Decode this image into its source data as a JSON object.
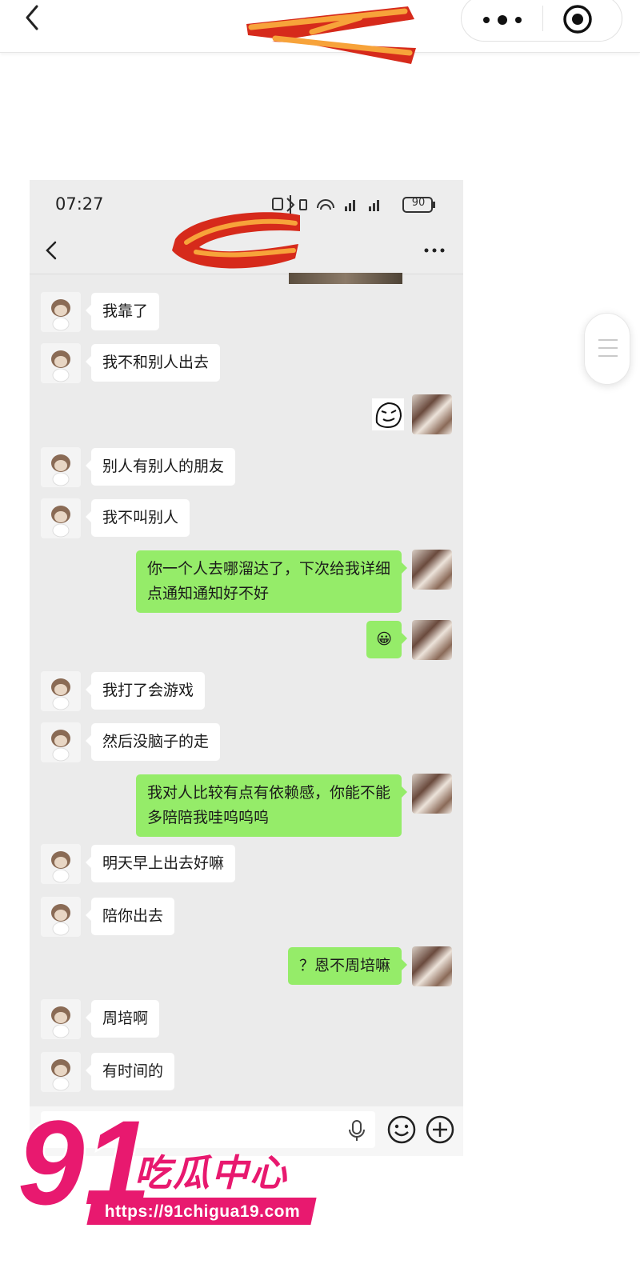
{
  "status_bar": {
    "time": "07:27",
    "battery": "90"
  },
  "messages": [
    {
      "side": "in",
      "type": "text",
      "lines": [
        "我靠了"
      ]
    },
    {
      "side": "in",
      "type": "text",
      "lines": [
        "我不和别人出去"
      ]
    },
    {
      "side": "out",
      "type": "sticker",
      "sticker": "meme-face-sticker"
    },
    {
      "side": "in",
      "type": "text",
      "lines": [
        "别人有别人的朋友"
      ]
    },
    {
      "side": "in",
      "type": "text",
      "lines": [
        "我不叫别人"
      ]
    },
    {
      "side": "out",
      "type": "text",
      "lines": [
        "你一个人去哪溜达了，下次给我详细",
        "点通知通知好不好"
      ]
    },
    {
      "side": "out",
      "type": "emoji",
      "emoji": "😀"
    },
    {
      "side": "in",
      "type": "text",
      "lines": [
        "我打了会游戏"
      ]
    },
    {
      "side": "in",
      "type": "text",
      "lines": [
        "然后没脑子的走"
      ]
    },
    {
      "side": "out",
      "type": "text",
      "lines": [
        "我对人比较有点有依赖感，你能不能",
        "多陪陪我哇呜呜呜"
      ]
    },
    {
      "side": "in",
      "type": "text",
      "lines": [
        "明天早上出去好嘛"
      ]
    },
    {
      "side": "in",
      "type": "text",
      "lines": [
        "陪你出去"
      ]
    },
    {
      "side": "out",
      "type": "text",
      "lines": [
        "？恩不周培嘛"
      ]
    },
    {
      "side": "in",
      "type": "text",
      "lines": [
        "周培啊"
      ]
    },
    {
      "side": "in",
      "type": "text",
      "lines": [
        "有时间的"
      ]
    }
  ],
  "watermark": {
    "number": "91",
    "title": "吃瓜中心",
    "url": "https://91chigua19.com"
  },
  "colors": {
    "out_bubble": "#95ec69",
    "in_bubble": "#ffffff",
    "chat_bg": "#ebebeb",
    "watermark": "#e8196f",
    "scribble_red": "#d62a1b",
    "scribble_orange": "#f7a33a"
  },
  "icons": [
    "back-icon",
    "more-dots-icon",
    "target-icon",
    "menu-handle-icon",
    "voice-icon",
    "emoji-icon",
    "plus-icon"
  ]
}
